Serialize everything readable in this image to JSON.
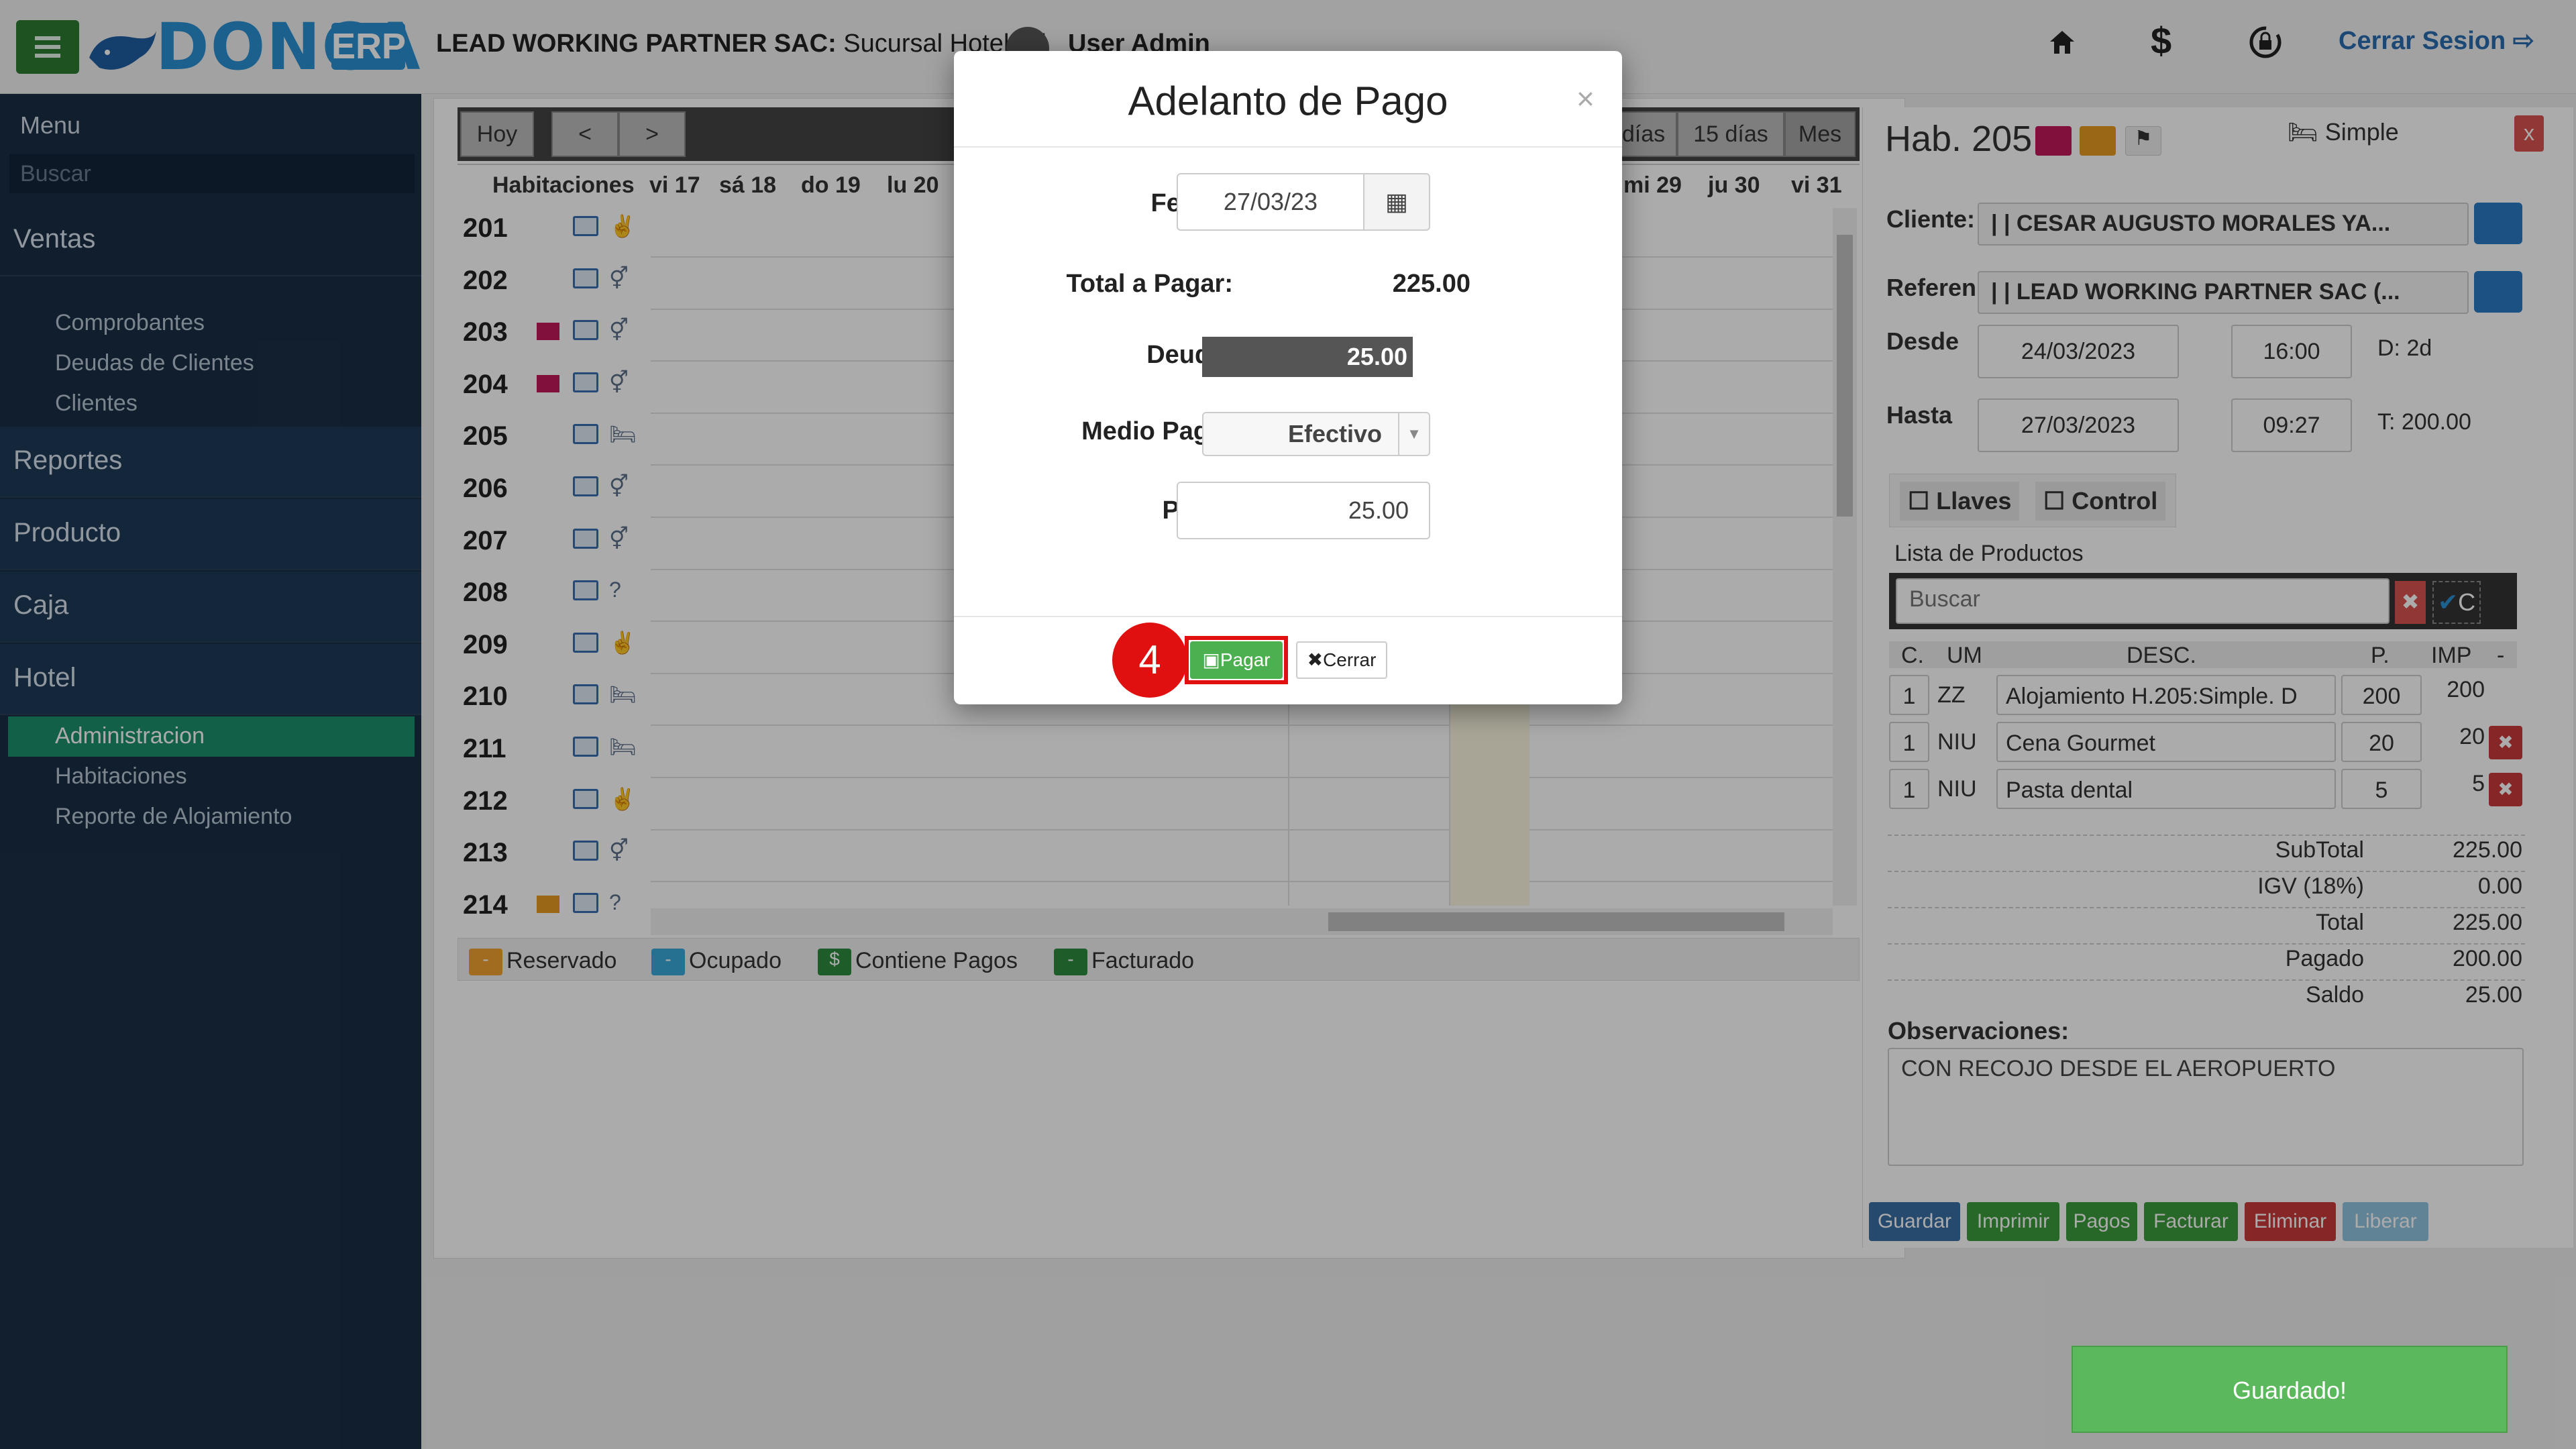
{
  "topbar": {
    "logo": "DONCA",
    "logo_suffix": "ERP",
    "company_bold": "LEAD WORKING PARTNER SAC:",
    "company_rest": " Sucursal Hotel -- |",
    "user": "User Admin",
    "logout": "Cerrar Sesion",
    "icons": [
      "home-icon",
      "dollar-icon",
      "lock-rotate-icon",
      "logout-icon"
    ]
  },
  "sidebar": {
    "menu_label": "Menu",
    "search_placeholder": "Buscar",
    "sections": [
      {
        "label": "Ventas",
        "items": [
          "Comprobantes",
          "Deudas de Clientes",
          "Clientes"
        ]
      },
      {
        "label": "Reportes"
      },
      {
        "label": "Producto"
      },
      {
        "label": "Caja"
      },
      {
        "label": "Hotel",
        "items": [
          "Administracion",
          "Habitaciones",
          "Reporte de Alojamiento"
        ]
      }
    ],
    "active_item": "Administracion"
  },
  "calendar": {
    "toolbar": {
      "today": "Hoy",
      "prev": "<",
      "next": ">",
      "view_days": "días",
      "view_15": "15 días",
      "view_month": "Mes"
    },
    "rooms_header": "Habitaciones",
    "days_left": [
      "vi 17",
      "sá 18",
      "do 19",
      "lu 20"
    ],
    "days_right": [
      "mi 29",
      "ju 30",
      "vi 31"
    ],
    "rooms": [
      {
        "n": "201",
        "flag": "",
        "icon": "peace-icon"
      },
      {
        "n": "202",
        "flag": "",
        "icon": "couple-icon"
      },
      {
        "n": "203",
        "flag": "red",
        "icon": "couple-icon"
      },
      {
        "n": "204",
        "flag": "red",
        "icon": "couple-icon"
      },
      {
        "n": "205",
        "flag": "",
        "icon": "bed-icon"
      },
      {
        "n": "206",
        "flag": "",
        "icon": "couple-icon"
      },
      {
        "n": "207",
        "flag": "",
        "icon": "couple-icon"
      },
      {
        "n": "208",
        "flag": "",
        "icon": "question-icon"
      },
      {
        "n": "209",
        "flag": "",
        "icon": "peace-icon"
      },
      {
        "n": "210",
        "flag": "",
        "icon": "bed-icon"
      },
      {
        "n": "211",
        "flag": "",
        "icon": "bed-icon"
      },
      {
        "n": "212",
        "flag": "",
        "icon": "peace-icon"
      },
      {
        "n": "213",
        "flag": "",
        "icon": "couple-icon"
      },
      {
        "n": "214",
        "flag": "orange",
        "icon": "question-icon"
      }
    ],
    "legend": [
      {
        "label": "Reservado",
        "mark": "-",
        "color": "#f0a030"
      },
      {
        "label": "Ocupado",
        "mark": "-",
        "color": "#3aa8d8"
      },
      {
        "label": "Contiene Pagos",
        "mark": "$",
        "color": "#2e8b3e"
      },
      {
        "label": "Facturado",
        "mark": "-",
        "color": "#2e8b3e"
      }
    ]
  },
  "detail": {
    "title": "Hab. 205",
    "type": "Simple",
    "close": "x",
    "cliente_label": "Cliente:",
    "cliente_value": "| | CESAR AUGUSTO MORALES YA...",
    "referente_label": "Referen",
    "referente_value": "| | LEAD WORKING PARTNER SAC (...",
    "desde_label": "Desde",
    "desde_date": "24/03/2023",
    "desde_time": "16:00",
    "days": "D: 2d",
    "hasta_label": "Hasta",
    "hasta_date": "27/03/2023",
    "hasta_time": "09:27",
    "total_short": "T: 200.00",
    "llaves": "Llaves",
    "control": "Control",
    "products_title": "Lista de Productos",
    "search_placeholder": "Buscar",
    "check_label": "C",
    "columns": [
      "C.",
      "UM",
      "DESC.",
      "P.",
      "IMP",
      "-"
    ],
    "products": [
      {
        "c": "1",
        "um": "ZZ",
        "desc": "Alojamiento H.205:Simple. D",
        "p": "200",
        "imp": "200",
        "deletable": false
      },
      {
        "c": "1",
        "um": "NIU",
        "desc": "Cena Gourmet",
        "p": "20",
        "imp": "20",
        "deletable": true
      },
      {
        "c": "1",
        "um": "NIU",
        "desc": "Pasta dental",
        "p": "5",
        "imp": "5",
        "deletable": true
      }
    ],
    "totals": [
      {
        "label": "SubTotal",
        "value": "225.00"
      },
      {
        "label": "IGV (18%)",
        "value": "0.00"
      },
      {
        "label": "Total",
        "value": "225.00"
      },
      {
        "label": "Pagado",
        "value": "200.00"
      },
      {
        "label": "Saldo",
        "value": "25.00"
      }
    ],
    "obs_label": "Observaciones:",
    "obs_value": "CON RECOJO DESDE EL AEROPUERTO",
    "actions": [
      {
        "label": "Guardar",
        "color": "#3a6ea5"
      },
      {
        "label": "Imprimir",
        "color": "#3b9a3b"
      },
      {
        "label": "Pagos",
        "color": "#3b9a3b"
      },
      {
        "label": "Facturar",
        "color": "#3b9a3b"
      },
      {
        "label": "Eliminar",
        "color": "#c93a3a"
      },
      {
        "label": "Liberar",
        "color": "#8fc3e0"
      }
    ]
  },
  "modal": {
    "title": "Adelanto de Pago",
    "close": "×",
    "fecha_label": "Fecha:",
    "fecha_value": "27/03/23",
    "total_label": "Total a Pagar:",
    "total_value": "225.00",
    "deuda_label": "Deuda:",
    "deuda_value": "25.00",
    "medio_label": "Medio Pago:",
    "medio_value": "Efectivo",
    "pago_label": "Pago:",
    "pago_value": "25.00",
    "pay_button": "Pagar",
    "close_button": "Cerrar",
    "step_badge": "4"
  },
  "toast": "Guardado!"
}
